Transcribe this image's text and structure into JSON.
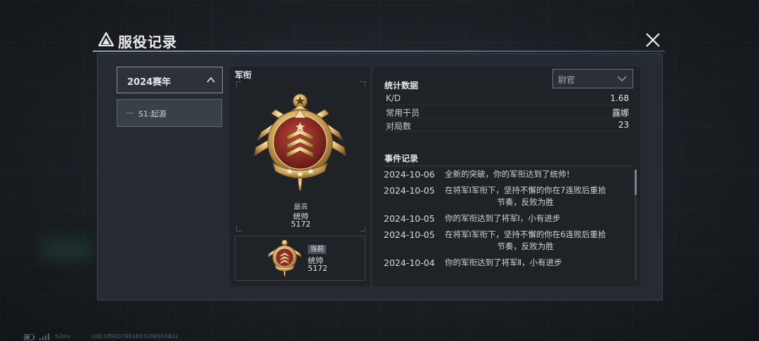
{
  "window": {
    "title": "服役记录"
  },
  "seasons": {
    "selected": "2024赛年",
    "items": [
      {
        "dash": "—",
        "label": "S1:起源"
      }
    ]
  },
  "rank": {
    "heading": "军衔",
    "highest_label": "最高",
    "highest_name": "统帅",
    "highest_points": "5172",
    "current_tag": "当前",
    "current_name": "统帅",
    "current_points": "5172"
  },
  "stats": {
    "filter_value": "尉官",
    "heading": "统计数据",
    "rows": [
      {
        "key": "K/D",
        "value": "1.68"
      },
      {
        "key": "常用干员",
        "value": "露娜"
      },
      {
        "key": "对局数",
        "value": "23"
      }
    ]
  },
  "events": {
    "heading": "事件记录",
    "items": [
      {
        "date": "2024-10-06",
        "text": "全新的突破，你的军衔达到了统帅！",
        "text2": ""
      },
      {
        "date": "2024-10-05",
        "text": "在将军Ⅰ军衔下，坚持不懈的你在7连败后重拾",
        "text2": "节奏，反败为胜"
      },
      {
        "date": "2024-10-05",
        "text": "你的军衔达到了将军Ⅰ，小有进步",
        "text2": ""
      },
      {
        "date": "2024-10-05",
        "text": "在将军Ⅰ军衔下，坚持不懈的你在6连败后重拾",
        "text2": "节奏，反败为胜"
      },
      {
        "date": "2024-10-04",
        "text": "你的军衔达到了将军Ⅱ，小有进步",
        "text2": ""
      }
    ]
  },
  "footer": {
    "ping": "52ms",
    "uid": "UID:18900790165328656383​2"
  },
  "colors": {
    "gold": "#d8b060",
    "crimson": "#8e2a26",
    "panel": "#262b31",
    "column": "#1f2328"
  },
  "icons": [
    "logo-icon",
    "close-icon",
    "chevron-up-icon",
    "chevron-down-icon",
    "rank-badge-icon",
    "battery-icon",
    "signal-icon"
  ]
}
